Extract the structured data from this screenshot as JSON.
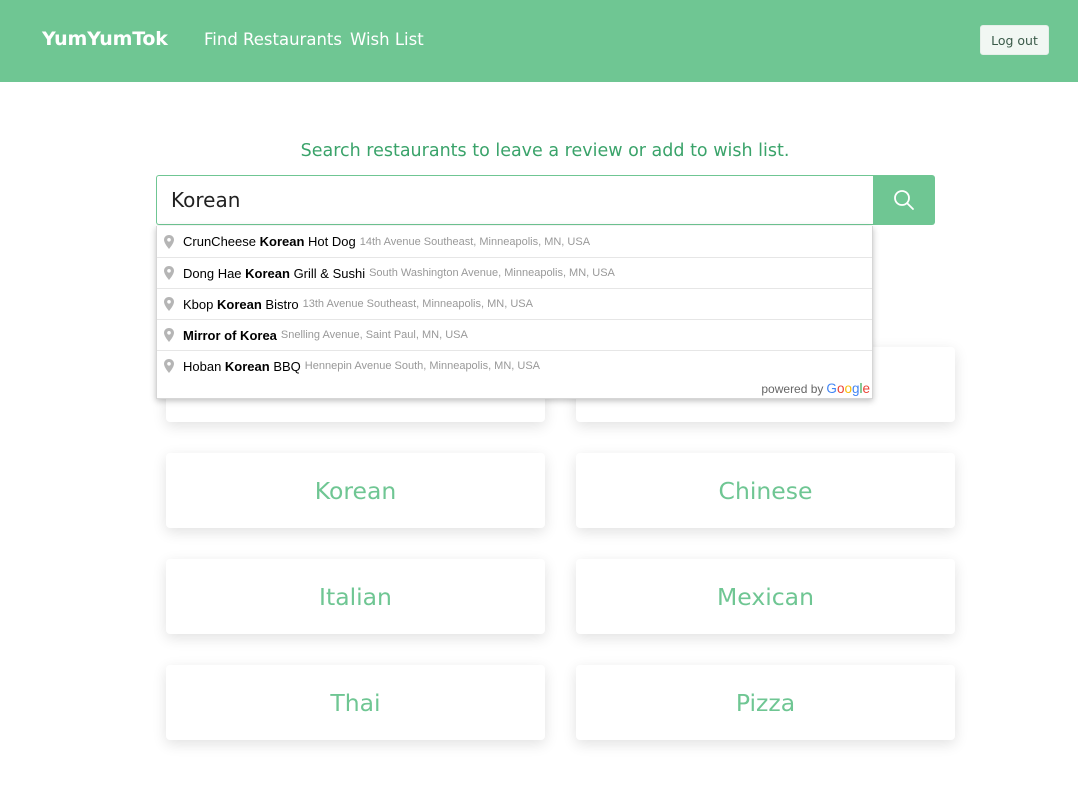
{
  "header": {
    "brand": "YumYumTok",
    "nav": [
      {
        "label": "Find Restaurants"
      },
      {
        "label": "Wish List"
      }
    ],
    "logout_label": "Log out"
  },
  "search": {
    "prompt": "Search restaurants to leave a review or add to wish list.",
    "value": "Korean",
    "button_icon": "search-icon"
  },
  "autocomplete": {
    "items": [
      {
        "pre": "CrunCheese ",
        "match": "Korean",
        "post": " Hot Dog",
        "address": "14th Avenue Southeast, Minneapolis, MN, USA"
      },
      {
        "pre": "Dong Hae ",
        "match": "Korean",
        "post": " Grill & Sushi",
        "address": "South Washington Avenue, Minneapolis, MN, USA"
      },
      {
        "pre": "Kbop ",
        "match": "Korean",
        "post": " Bistro",
        "address": "13th Avenue Southeast, Minneapolis, MN, USA"
      },
      {
        "pre": "",
        "match": "Mirror of Korea",
        "post": "",
        "address": "Snelling Avenue, Saint Paul, MN, USA"
      },
      {
        "pre": "Hoban ",
        "match": "Korean",
        "post": " BBQ",
        "address": "Hennepin Avenue South, Minneapolis, MN, USA"
      }
    ],
    "powered_by": "powered by",
    "google_letters": [
      "G",
      "o",
      "o",
      "g",
      "l",
      "e"
    ],
    "google_colors": [
      "#4285F4",
      "#EA4335",
      "#FBBC05",
      "#4285F4",
      "#34A853",
      "#EA4335"
    ]
  },
  "categories": [
    {
      "label": ""
    },
    {
      "label": ""
    },
    {
      "label": "Korean"
    },
    {
      "label": "Chinese"
    },
    {
      "label": "Italian"
    },
    {
      "label": "Mexican"
    },
    {
      "label": "Thai"
    },
    {
      "label": "Pizza"
    }
  ],
  "colors": {
    "brand_green": "#6fc693",
    "prompt_green": "#3aa36a"
  }
}
